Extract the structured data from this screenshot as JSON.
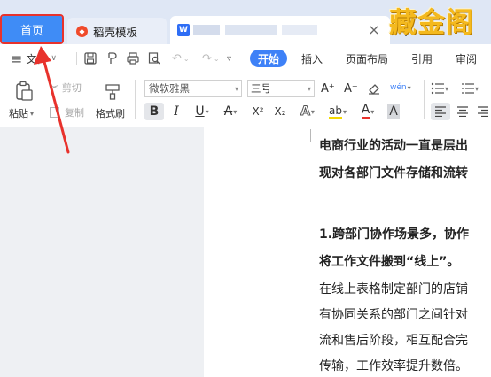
{
  "tabs": {
    "home": "首页",
    "templates": "稻壳模板",
    "doc_icon_letter": "W",
    "close": "×",
    "add": "+"
  },
  "watermark": "藏金阁",
  "menu": {
    "hamburger": "≡",
    "file": "文件",
    "file_caret": "∨",
    "start": "开始",
    "insert": "插入",
    "page_layout": "页面布局",
    "references": "引用",
    "review": "审阅"
  },
  "ribbon": {
    "paste": "粘贴",
    "cut": "剪切",
    "copy": "复制",
    "format_painter": "格式刷",
    "font_name": "微软雅黑",
    "font_size": "三号",
    "bold": "B",
    "italic": "I",
    "underline": "U",
    "strike": "A",
    "superscript": "X²",
    "subscript": "X₂",
    "grow": "A⁺",
    "shrink": "A⁻",
    "phonetic": "wén",
    "font_color_a": "A",
    "shade_a": "A"
  },
  "document": {
    "lines": [
      "电商行业的活动一直是层出",
      "现对各部门文件存储和流转",
      "1.跨部门协作场景多，协作",
      "将工作文件搬到“线上”。",
      "在线上表格制定部门的店铺",
      "有协同关系的部门之间针对",
      "流和售后阶段，相互配合完",
      "传输，工作效率提升数倍。"
    ]
  },
  "colors": {
    "accent": "#3e81f7",
    "annotation": "#e8322c",
    "watermark": "#f4b91e"
  }
}
